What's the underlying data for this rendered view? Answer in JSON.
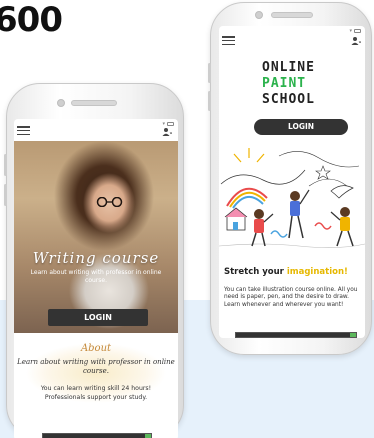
{
  "header": {
    "big_title": "600"
  },
  "left_phone": {
    "hero_title": "Writing course",
    "hero_subtitle": "Learn about writing with professor in online course.",
    "login_label": "LOGIN",
    "about_title": "About",
    "about_line": "Learn about writing with professor in online course.",
    "about_body": "You can learn writing skill 24 hours! Professionals support your study."
  },
  "right_phone": {
    "brand_line1": "ONLINE",
    "brand_line2": "PAINT",
    "brand_line3": "SCHOOL",
    "login_label": "LOGIN",
    "stretch_prefix": "Stretch your ",
    "stretch_highlight": "imagination!",
    "body": "You can take illustration course online. All you need is paper, pen, and the desire to draw. Learn whenever and wherever you want!"
  },
  "colors": {
    "brand_green": "#2bb24c",
    "highlight_yellow": "#e6b800",
    "button_dark": "#333333",
    "about_gold": "#c58a3c",
    "band_blue": "#e6f1fb"
  },
  "icons": [
    "hamburger-menu-icon",
    "user-icon",
    "chevron-down-icon",
    "wifi-icon",
    "battery-icon"
  ]
}
